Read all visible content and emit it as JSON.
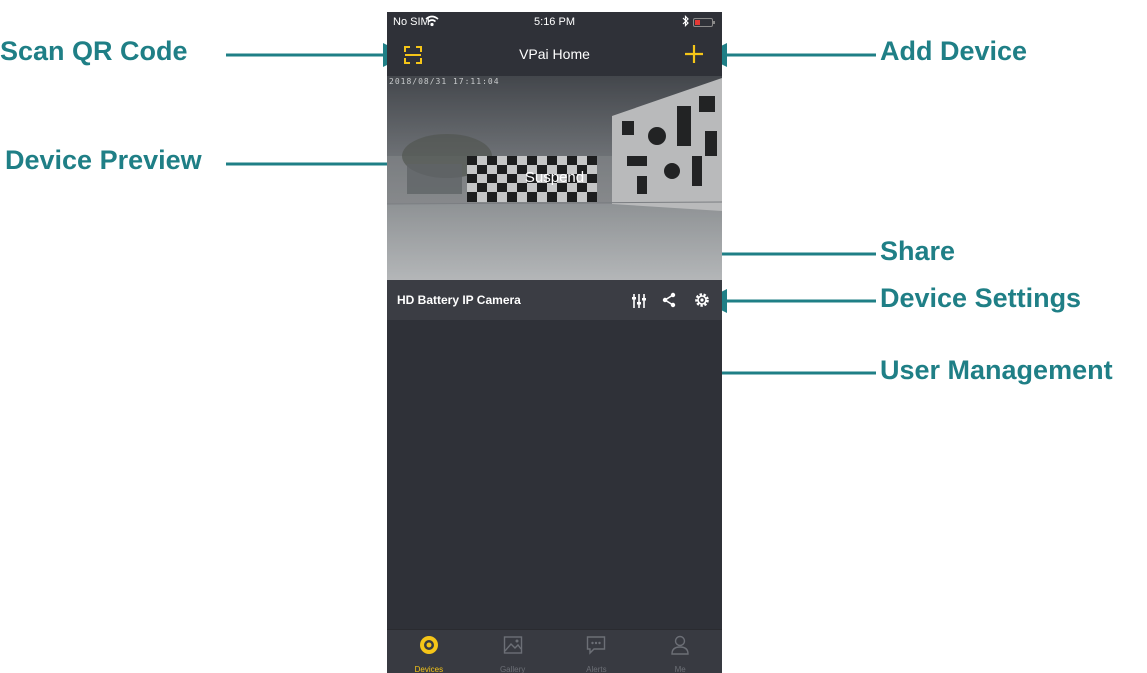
{
  "status_bar": {
    "carrier": "No SIM",
    "time": "5:16 PM"
  },
  "nav": {
    "title": "VPai Home"
  },
  "preview": {
    "timestamp": "2018/08/31 17:11:04",
    "status": "Suspend"
  },
  "device": {
    "name": "HD Battery IP Camera"
  },
  "tabs": [
    {
      "label": "Devices",
      "icon": "devices-icon",
      "active": true
    },
    {
      "label": "Gallery",
      "icon": "gallery-icon",
      "active": false
    },
    {
      "label": "Alerts",
      "icon": "alerts-icon",
      "active": false
    },
    {
      "label": "Me",
      "icon": "person-icon",
      "active": false
    }
  ],
  "callouts": {
    "scan_qr": "Scan QR Code",
    "add_device": "Add Device",
    "device_preview": "Device Preview",
    "share": "Share",
    "device_settings": "Device Settings",
    "user_management": "User Management"
  },
  "colors": {
    "accent": "#f5c518",
    "callout": "#1f7f86",
    "background": "#2f3138"
  }
}
